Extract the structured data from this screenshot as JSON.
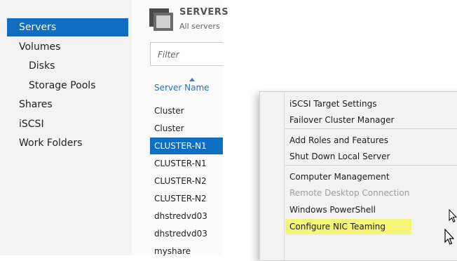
{
  "nav": {
    "items": [
      {
        "label": "Servers"
      },
      {
        "label": "Volumes"
      },
      {
        "label": "Disks"
      },
      {
        "label": "Storage Pools"
      },
      {
        "label": "Shares"
      },
      {
        "label": "iSCSI"
      },
      {
        "label": "Work Folders"
      }
    ]
  },
  "servers_pane": {
    "title": "SERVERS",
    "subtitle": "All servers",
    "filter_placeholder": "Filter",
    "column_header": "Server Name",
    "rows": [
      {
        "name": "Cluster"
      },
      {
        "name": "Cluster"
      },
      {
        "name": "CLUSTER-N1"
      },
      {
        "name": "CLUSTER-N1"
      },
      {
        "name": "CLUSTER-N2"
      },
      {
        "name": "CLUSTER-N2"
      },
      {
        "name": "dhstredvd03"
      },
      {
        "name": "dhstredvd03"
      },
      {
        "name": "myshare"
      }
    ]
  },
  "context_menu": {
    "items": [
      {
        "label": "iSCSI Target Settings"
      },
      {
        "label": "Failover Cluster Manager"
      },
      {
        "label": "Add Roles and Features"
      },
      {
        "label": "Shut Down Local Server"
      },
      {
        "label": "Computer Management"
      },
      {
        "label": "Remote Desktop Connection",
        "disabled": true
      },
      {
        "label": "Windows PowerShell"
      },
      {
        "label": "Configure NIC Teaming",
        "highlighted": true
      }
    ]
  },
  "colors": {
    "selection": "#0f6ec1",
    "highlight": "#f5f577",
    "header_link": "#2a6eb8"
  },
  "icons": [
    "server-group-icon",
    "sort-ascending-icon",
    "mouse-pointer-icon"
  ]
}
